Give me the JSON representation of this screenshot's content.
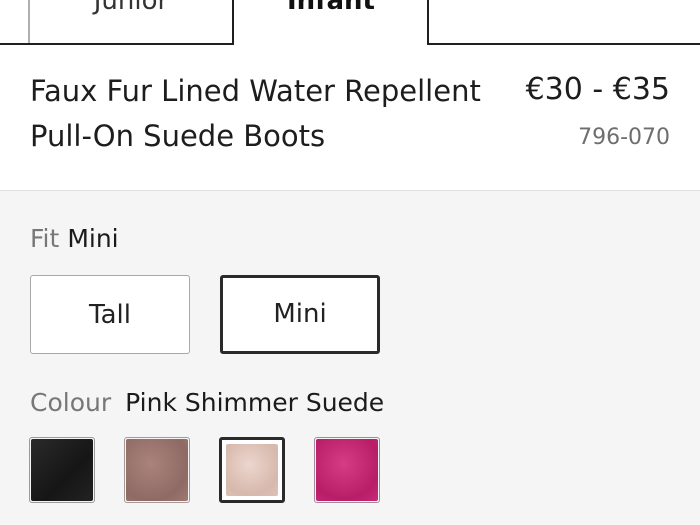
{
  "tabs": {
    "items": [
      {
        "label": "Junior",
        "active": false
      },
      {
        "label": "Infant",
        "active": true
      }
    ]
  },
  "product": {
    "title": "Faux Fur Lined Water Repellent Pull-On Suede Boots",
    "price": "€30 - €35",
    "code": "796-070"
  },
  "fit": {
    "label": "Fit",
    "selected": "Mini",
    "options": [
      {
        "label": "Tall",
        "selected": false
      },
      {
        "label": "Mini",
        "selected": true
      }
    ]
  },
  "colour": {
    "label": "Colour",
    "selected": "Pink Shimmer Suede",
    "swatches": [
      {
        "color": "#1e1e1e",
        "selected": false
      },
      {
        "color": "#987470",
        "selected": false
      },
      {
        "color": "#e2c7bc",
        "selected": true
      },
      {
        "color": "#c5266f",
        "selected": false
      }
    ]
  }
}
